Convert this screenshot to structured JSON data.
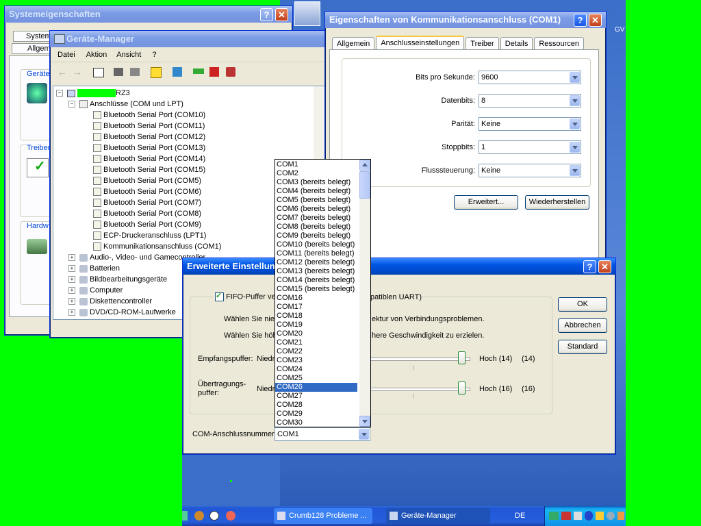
{
  "sysprops": {
    "title": "Systemeigenschaften",
    "tabs": [
      "System",
      "Allgem"
    ],
    "groups": [
      "Geräte",
      "Treiber",
      "Hardw"
    ]
  },
  "devmgr": {
    "title": "Geräte-Manager",
    "menu": [
      "Datei",
      "Aktion",
      "Ansicht",
      "?"
    ],
    "root": "RZ3",
    "category": "Anschlüsse (COM und LPT)",
    "ports": [
      "Bluetooth Serial Port (COM10)",
      "Bluetooth Serial Port (COM11)",
      "Bluetooth Serial Port (COM12)",
      "Bluetooth Serial Port (COM13)",
      "Bluetooth Serial Port (COM14)",
      "Bluetooth Serial Port (COM15)",
      "Bluetooth Serial Port (COM5)",
      "Bluetooth Serial Port (COM6)",
      "Bluetooth Serial Port (COM7)",
      "Bluetooth Serial Port (COM8)",
      "Bluetooth Serial Port (COM9)",
      "ECP-Druckeranschluss (LPT1)",
      "Kommunikationsanschluss (COM1)"
    ],
    "others": [
      "Audio-, Video- und Gamecontroller",
      "Batterien",
      "Bildbearbeitungsgeräte",
      "Computer",
      "Diskettencontroller",
      "DVD/CD-ROM-Laufwerke"
    ]
  },
  "comprops": {
    "title": "Eigenschaften von Kommunikationsanschluss (COM1)",
    "tabs": [
      "Allgemein",
      "Anschlusseinstellungen",
      "Treiber",
      "Details",
      "Ressourcen"
    ],
    "fields": [
      {
        "label": "Bits pro Sekunde:",
        "value": "9600"
      },
      {
        "label": "Datenbits:",
        "value": "8"
      },
      {
        "label": "Parität:",
        "value": "Keine"
      },
      {
        "label": "Stoppbits:",
        "value": "1"
      },
      {
        "label": "Flusssteuerung:",
        "value": "Keine"
      }
    ],
    "advanced_button": "Erweitert...",
    "restore_button": "Wiederherstellen"
  },
  "advanced": {
    "title": "Erweiterte Einstellun",
    "fifo_label_left": "FIFO-Puffer ver",
    "fifo_label_right": "patiblen UART)",
    "hint1_left": "Wählen Sie nie",
    "hint1_right": "ektur von Verbindungsproblemen.",
    "hint2_left": "Wählen Sie höh",
    "hint2_right": "here Geschwindigkeit zu erzielen.",
    "receive_label": "Empfangspuffer:",
    "receive_low": "Niedr",
    "receive_high": "Hoch (14)",
    "receive_value": "(14)",
    "transmit_label": "Übertragungs-\npuffer:",
    "transmit_low": "Niedr",
    "transmit_high": "Hoch (16)",
    "transmit_value": "(16)",
    "com_label": "COM-Anschlussnummer:",
    "com_value": "COM1",
    "ok": "OK",
    "cancel": "Abbrechen",
    "default": "Standard",
    "receive_level": 1.0,
    "transmit_level": 1.0
  },
  "dropdown": {
    "items": [
      "COM1",
      "COM2",
      "COM3 (bereits belegt)",
      "COM4 (bereits belegt)",
      "COM5 (bereits belegt)",
      "COM6 (bereits belegt)",
      "COM7 (bereits belegt)",
      "COM8 (bereits belegt)",
      "COM9 (bereits belegt)",
      "COM10 (bereits belegt)",
      "COM11 (bereits belegt)",
      "COM12 (bereits belegt)",
      "COM13 (bereits belegt)",
      "COM14 (bereits belegt)",
      "COM15 (bereits belegt)",
      "COM16",
      "COM17",
      "COM18",
      "COM19",
      "COM20",
      "COM21",
      "COM22",
      "COM23",
      "COM24",
      "COM25",
      "COM26",
      "COM27",
      "COM28",
      "COM29",
      "COM30"
    ],
    "selected": "COM26"
  },
  "taskbar": {
    "task1": "Crumb128 Probleme ...",
    "task2": "Geräte-Manager",
    "lang": "DE"
  },
  "desktop_text": "GV"
}
